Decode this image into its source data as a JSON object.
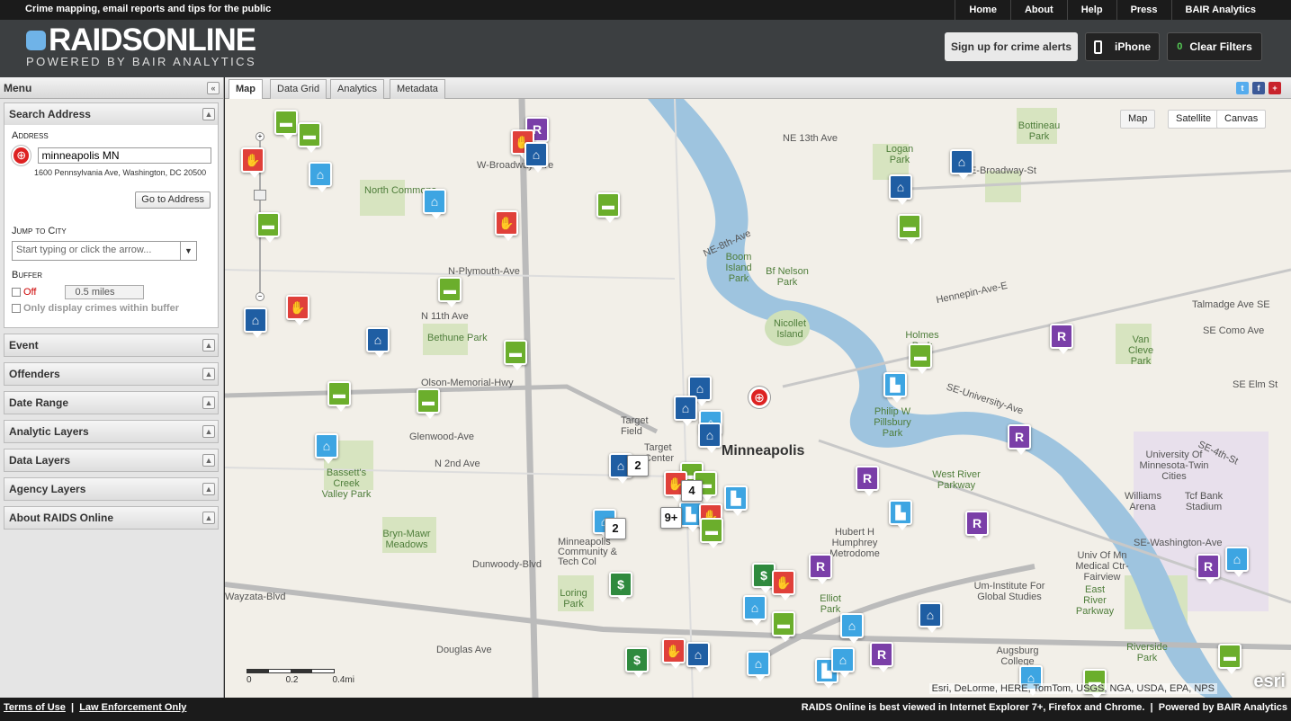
{
  "topbar": {
    "tagline": "Crime mapping, email reports and tips for the public",
    "nav": [
      "Home",
      "About",
      "Help",
      "Press",
      "BAIR Analytics"
    ]
  },
  "header": {
    "logo_main": "RAIDSONLINE",
    "logo_sub": "POWERED BY BAIR ANALYTICS",
    "signup_label": "Sign up for crime alerts",
    "iphone_label": "iPhone",
    "clear_count": "0",
    "clear_label": "Clear Filters"
  },
  "sidebar": {
    "menu_title": "Menu",
    "search_title": "Search Address",
    "address_label": "Address",
    "address_value": "minneapolis MN",
    "address_hint": "1600 Pennsylvania Ave, Washington, DC 20500",
    "goto_label": "Go to Address",
    "jump_label": "Jump to City",
    "city_placeholder": "Start typing or click the arrow...",
    "buffer_label": "Buffer",
    "buffer_off": "Off",
    "buffer_miles": "0.5 miles",
    "only_within": "Only display crimes within buffer",
    "panels": [
      "Event",
      "Offenders",
      "Date Range",
      "Analytic Layers",
      "Data Layers",
      "Agency Layers",
      "About RAIDS Online"
    ]
  },
  "tabs": [
    "Map",
    "Data Grid",
    "Analytics",
    "Metadata"
  ],
  "map": {
    "type_buttons": [
      "Map",
      "Satellite",
      "Canvas"
    ],
    "labels": {
      "city": "Minneapolis",
      "streets": [
        "W-Broadway-Ave",
        "NE-Broadway-St",
        "N-Plymouth-Ave",
        "NE-8th-Ave",
        "Olson-Memorial-Hwy",
        "Glenwood-Ave",
        "Hennepin-Ave-E",
        "SE-University-Ave",
        "N 11th Ave",
        "N 2nd Ave",
        "Dunwoody-Blvd",
        "Wayzata-Blvd",
        "Douglas Ave",
        "NE 13th Ave",
        "Talmadge Ave SE",
        "SE Como Ave",
        "SE Elm St",
        "SE-4th-St",
        "SE-Washington-Ave"
      ],
      "parks": [
        "North Commons",
        "Bethune Park",
        "Boom Island Park",
        "Bf Nelson Park",
        "Nicollet Island",
        "Logan Park",
        "Bottineau Park",
        "Holmes Park",
        "Van Cleve Park",
        "Philip W Pillsbury Park",
        "Bassett's Creek Valley Park",
        "Bryn-Mawr Meadows",
        "Loring Park",
        "Elliot Park",
        "West River Parkway",
        "East River Parkway",
        "Riverside Park"
      ],
      "places": [
        "Target Field",
        "Target Center",
        "Minneapolis Community & Tech Col",
        "Hubert H Humphrey Metrodome",
        "University Of Minnesota-Twin Cities",
        "Williams Arena",
        "Tcf Bank Stadium",
        "Univ Of Mn Medical Ctr-Fairview",
        "Um-Institute For Global Studies",
        "Augsburg College"
      ]
    },
    "clusters": [
      "2",
      "4",
      "9+",
      "2"
    ],
    "scale": [
      "0",
      "0.2",
      "0.4mi"
    ],
    "attribution": "Esri, DeLorme, HERE, TomTom, USGS, NGA, USDA, EPA, NPS",
    "esri": "esri"
  },
  "footer": {
    "terms": "Terms of Use",
    "law": "Law Enforcement Only",
    "browser_note": "RAIDS Online is best viewed in Internet Explorer 7+, Firefox and Chrome.",
    "powered": "Powered by",
    "powered_brand": "BAIR Analytics"
  }
}
